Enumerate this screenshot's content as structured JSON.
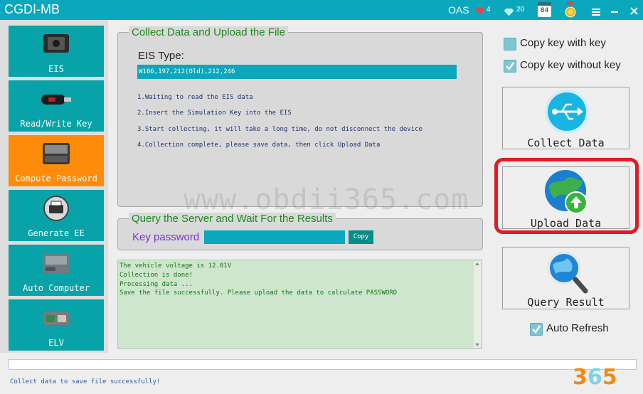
{
  "window": {
    "title": "CGDI-MB",
    "oas": "OAS",
    "hearts": "4",
    "gems": "20",
    "calendar": "84",
    "menu_icon": "menu-icon",
    "close_icon": "close-icon"
  },
  "sidebar": {
    "items": [
      {
        "label": "EIS",
        "icon": "eis-module-icon"
      },
      {
        "label": "Read/Write Key",
        "icon": "car-key-icon"
      },
      {
        "label": "Compute Password",
        "icon": "keyboard-icon"
      },
      {
        "label": "Generate EE",
        "icon": "printer-icon"
      },
      {
        "label": "Auto Computer",
        "icon": "ecu-icon"
      },
      {
        "label": "ELV",
        "icon": "elv-module-icon"
      }
    ]
  },
  "collect": {
    "title": "Collect Data and Upload the File",
    "eis_label": "EIS Type:",
    "eis_value": "W166,197,212(Old),212,246",
    "steps": [
      "1.Waiting to read the EIS data",
      "2.Insert the Simulation Key into the EIS",
      "3.Start collecting, it will take a long time, do not disconnect the device",
      "4.Collection complete, please save data, then click Upload Data"
    ]
  },
  "watermark": "www.obdii365.com",
  "query": {
    "title": "Query the Server and Wait For the Results",
    "key_label": "Key password",
    "key_value": "",
    "copy_label": "Copy"
  },
  "log": {
    "lines": [
      "The vehicle voltage is 12.01V",
      "Collection is done!",
      "Processing data ...",
      "Save the file successfully. Please upload the data to calculate PASSWORD"
    ]
  },
  "options": {
    "copy_with_key": "Copy key with key",
    "copy_without_key": "Copy key without key",
    "copy_with_key_checked": false,
    "copy_without_key_checked": true,
    "auto_refresh": "Auto Refresh",
    "auto_refresh_checked": true
  },
  "actions": {
    "collect": "Collect Data",
    "upload": "Upload  Data",
    "query": "Query Result"
  },
  "status": "Collect data to save file successfully!",
  "logo": "365",
  "colors": {
    "title_bar": "#0aa7bd",
    "nav": "#07a3a8",
    "nav_active": "#ff8b0b",
    "highlight": "#e11a24"
  }
}
